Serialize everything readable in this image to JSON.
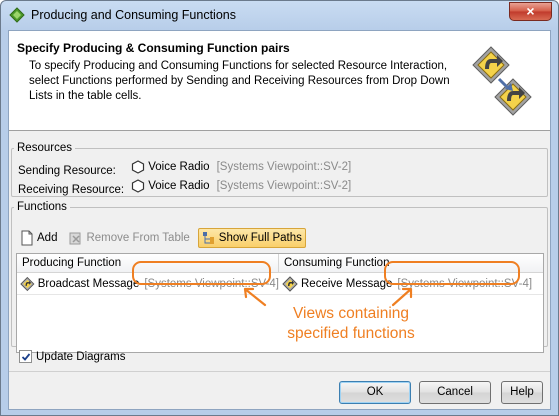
{
  "window": {
    "title": "Producing and Consuming Functions",
    "close_label": "×"
  },
  "header": {
    "title": "Specify Producing & Consuming Function pairs",
    "description": "To specify Producing and Consuming Functions for selected Resource Interaction, select Functions performed by Sending and Receiving Resources from Drop Down Lists in the table cells."
  },
  "resources": {
    "legend": "Resources",
    "sending": {
      "label": "Sending Resource:",
      "name": "Voice Radio",
      "path": "[Systems Viewpoint::SV-2]"
    },
    "receiving": {
      "label": "Receiving Resource:",
      "name": "Voice Radio",
      "path": "[Systems Viewpoint::SV-2]"
    }
  },
  "functions": {
    "legend": "Functions",
    "toolbar": {
      "add": "Add",
      "remove": "Remove From Table",
      "show_paths": "Show Full Paths"
    },
    "columns": [
      "Producing Function",
      "Consuming Function"
    ],
    "rows": [
      {
        "producing": {
          "name": "Broadcast Message",
          "path": "[Systems Viewpoint::SV-4]"
        },
        "consuming": {
          "name": "Receive Message",
          "path": "[Systems Viewpoint::SV-4]"
        }
      }
    ]
  },
  "annotation": {
    "line1": "Views containing",
    "line2": "specified functions",
    "color": "#ef7f22"
  },
  "update_diagrams": {
    "label": "Update Diagrams",
    "checked": true
  },
  "buttons": {
    "ok": "OK",
    "cancel": "Cancel",
    "help": "Help"
  }
}
